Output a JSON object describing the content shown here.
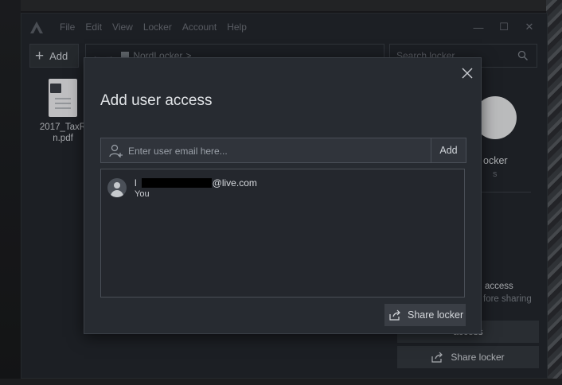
{
  "menu": [
    "File",
    "Edit",
    "View",
    "Locker",
    "Account",
    "Help"
  ],
  "window_controls": {
    "minimize": "—",
    "maximize": "☐",
    "close": "✕"
  },
  "toolbar": {
    "add_label": "Add",
    "breadcrumb": "NordLocker",
    "breadcrumb_sep": ">",
    "search_placeholder": "Search locker"
  },
  "file": {
    "name_line1": "2017_TaxR",
    "name_line2": "n.pdf"
  },
  "side_panel": {
    "title": "ocker",
    "sub": "s",
    "note1": "access",
    "note2": "fore sharing",
    "button1": "access",
    "button2": "Share locker"
  },
  "dialog": {
    "title": "Add user access",
    "email_placeholder": "Enter user email here...",
    "add_label": "Add",
    "users": [
      {
        "email_prefix": "l",
        "email_suffix": "@live.com",
        "role": "You"
      }
    ],
    "share_label": "Share locker"
  },
  "colors": {
    "accent": "#3a3e45",
    "background": "#23262c",
    "dialog": "#272b31"
  }
}
